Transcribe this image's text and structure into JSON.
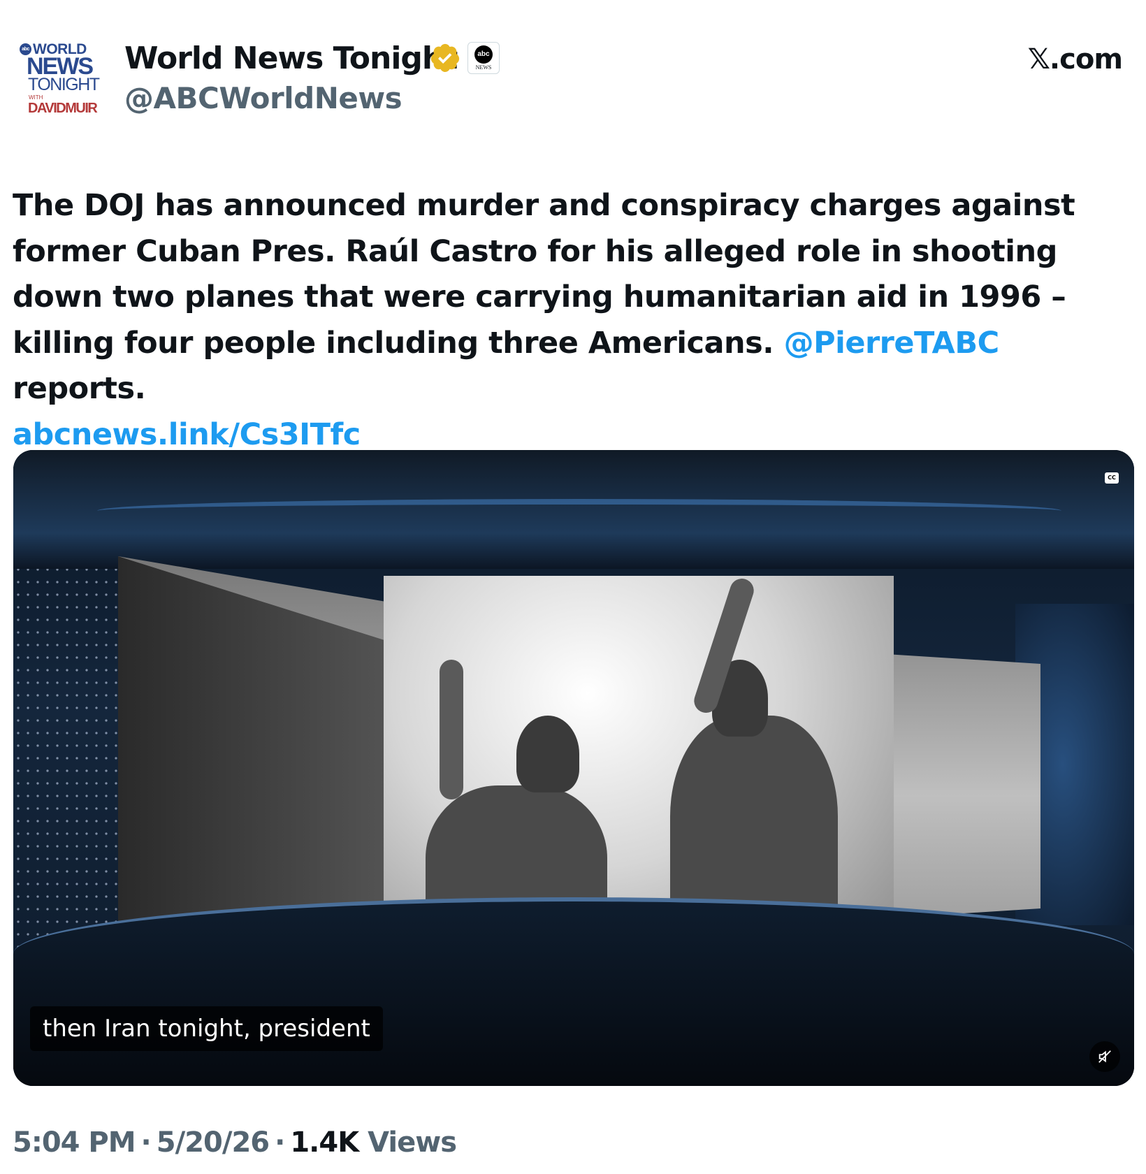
{
  "profile": {
    "display_name": "World News Tonight",
    "handle": "@ABCWorldNews",
    "avatar_text": {
      "world": "WORLD",
      "news": "NEWS",
      "tonight": "TONIGHT",
      "with": "WITH",
      "anchor": "DAVIDMUIR"
    },
    "affiliate_badge": {
      "logo": "abc",
      "label": "NEWS"
    },
    "verified_color": "#e8b722"
  },
  "site": "𝕏.com",
  "tweet": {
    "text_part1": "The DOJ has announced murder and conspiracy charges against former Cuban Pres. Raúl Castro for his alleged role in shooting down two planes that were carrying humanitarian aid in 1996 – killing four people including three Americans. ",
    "mention": "@PierreTABC",
    "text_part2": " reports.",
    "link": "abcnews.link/Cs3ITfc"
  },
  "video": {
    "caption": "then Iran tonight, president",
    "cc_label": "CC",
    "mute_icon": "muted-speaker-icon"
  },
  "meta": {
    "time": "5:04 PM",
    "date": "5/20/26",
    "views_count": "1.4K",
    "views_label": "Views"
  },
  "colors": {
    "link": "#1d9bf0",
    "secondary_text": "#536471",
    "primary_text": "#0f1419"
  }
}
